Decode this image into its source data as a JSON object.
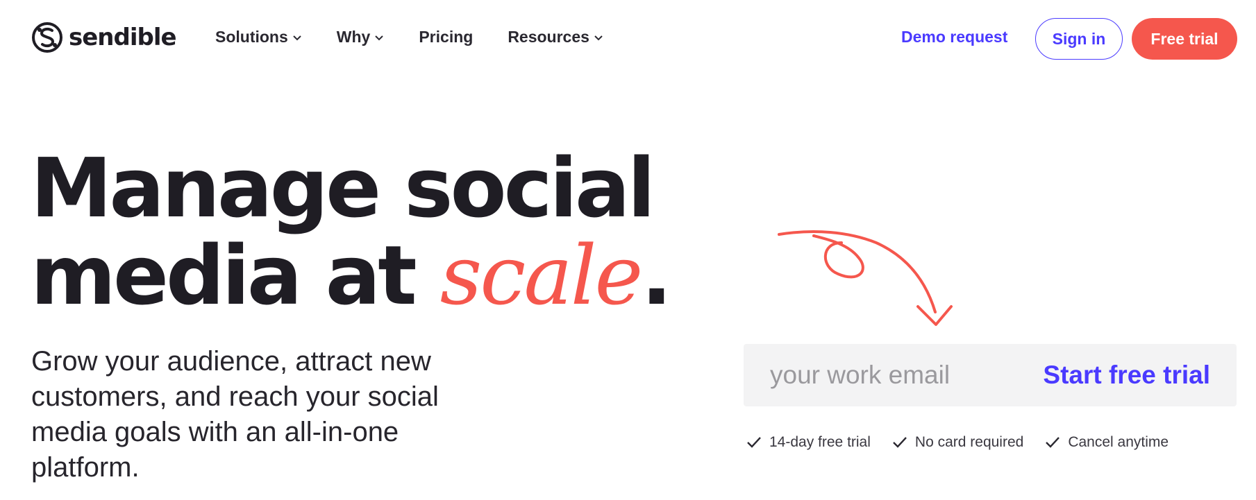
{
  "brand": {
    "name": "sendible",
    "logo_icon": "sendible-logo-icon"
  },
  "nav": {
    "items": [
      {
        "label": "Solutions",
        "has_dropdown": true
      },
      {
        "label": "Why",
        "has_dropdown": true
      },
      {
        "label": "Pricing",
        "has_dropdown": false
      },
      {
        "label": "Resources",
        "has_dropdown": true
      }
    ],
    "demo_label": "Demo request",
    "signin_label": "Sign in",
    "trial_label": "Free trial"
  },
  "hero": {
    "headline_line1": "Manage social",
    "headline_line2_prefix": "media at ",
    "headline_accent": "scale",
    "headline_suffix": ".",
    "subcopy": "Grow your audience, attract new customers, and reach your social media goals with an all-in-one platform."
  },
  "signup": {
    "email_placeholder": "your work email",
    "email_value": "",
    "start_label": "Start free trial"
  },
  "perks": [
    "14-day free trial",
    "No card required",
    "Cancel anytime"
  ],
  "colors": {
    "accent_purple": "#4a3aff",
    "accent_coral": "#f5574d",
    "text_dark": "#1f1d24",
    "input_bg": "#f3f3f4"
  }
}
